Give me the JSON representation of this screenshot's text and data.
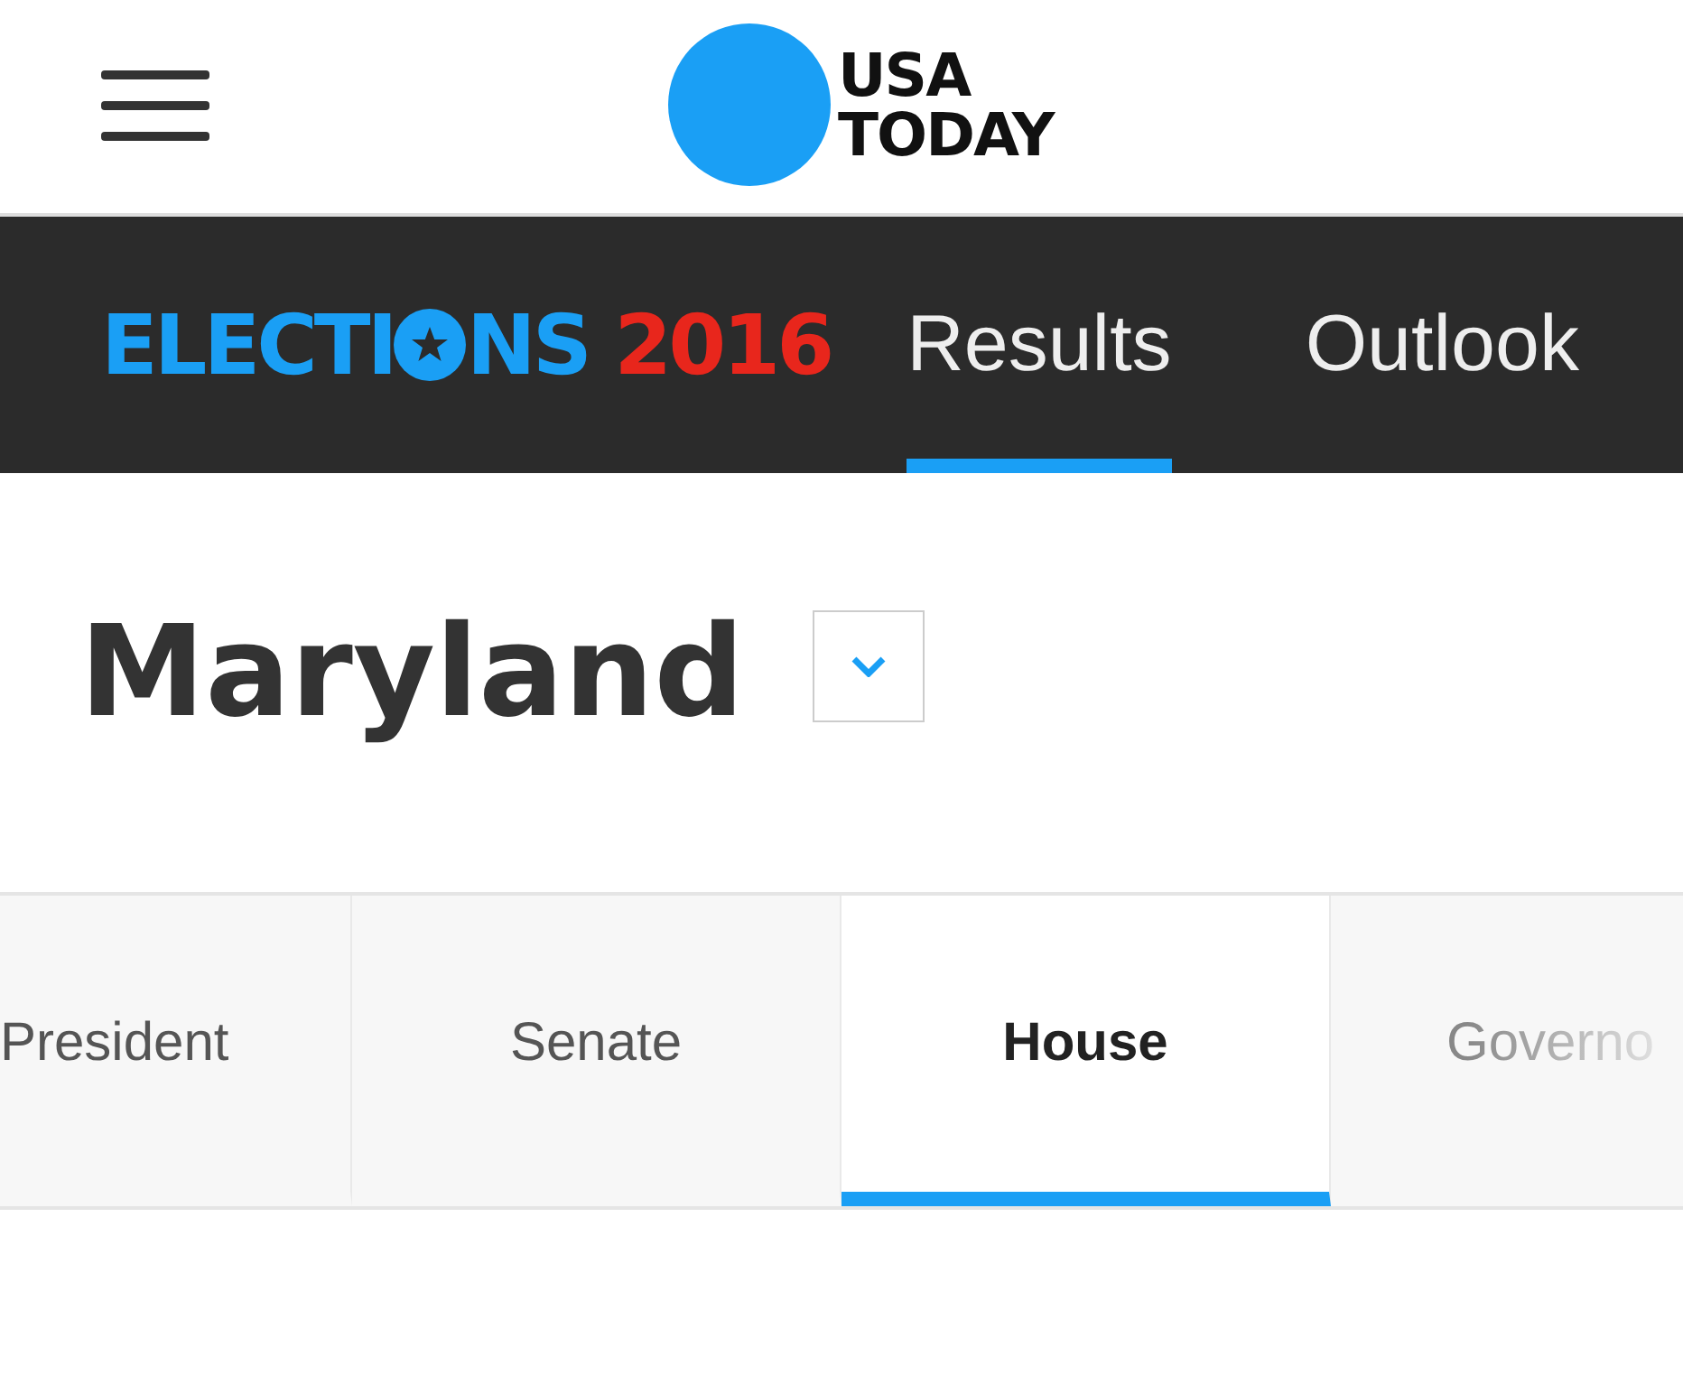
{
  "header": {
    "logo_line_1": "USA",
    "logo_line_2": "TODAY"
  },
  "elections_bar": {
    "logo_prefix": "ELECTI",
    "logo_suffix": "NS",
    "logo_year": "2016",
    "nav": [
      {
        "label": "Results",
        "selected": true
      },
      {
        "label": "Outlook",
        "selected": false
      }
    ]
  },
  "state": {
    "name": "Maryland"
  },
  "race_tabs": [
    {
      "label": "President",
      "selected": false
    },
    {
      "label": "Senate",
      "selected": false
    },
    {
      "label": "House",
      "selected": true
    },
    {
      "label": "Governo",
      "selected": false
    }
  ]
}
